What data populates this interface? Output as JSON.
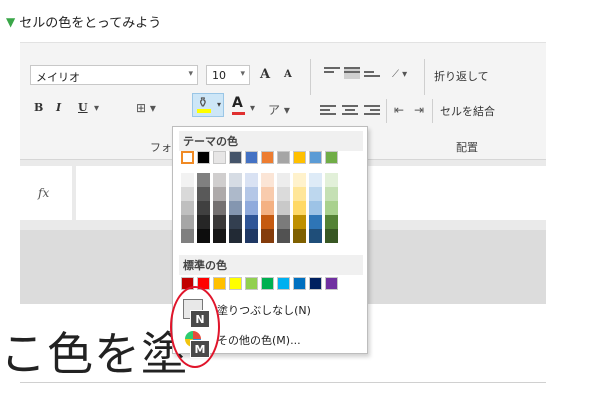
{
  "heading": "セルの色をとってみよう",
  "ribbon": {
    "font_name": "メイリオ",
    "font_size": "10",
    "bold": "B",
    "italic": "I",
    "underline": "U",
    "grow_font": "A",
    "shrink_font": "A",
    "font_color_label": "A",
    "wrap_label": "折り返して",
    "merge_label": "セルを結合",
    "font_group": "フォント",
    "align_group": "配置",
    "fill_color": "#ffff00",
    "font_color": "#e03030"
  },
  "formula_bar": {
    "fx": "fx"
  },
  "sheet": {
    "big_text": "こ色を塗"
  },
  "dropdown": {
    "theme_title": "テーマの色",
    "standard_title": "標準の色",
    "no_fill": "塗りつぶしなし(N)",
    "more_colors": "その他の色(M)...",
    "key_n": "N",
    "key_m": "M",
    "theme_colors": [
      "#ffffff",
      "#000000",
      "#e7e6e6",
      "#44546a",
      "#4472c4",
      "#ed7d31",
      "#a5a5a5",
      "#ffc000",
      "#5b9bd5",
      "#70ad47"
    ],
    "theme_shades": [
      [
        "#f2f2f2",
        "#d9d9d9",
        "#bfbfbf",
        "#a6a6a6",
        "#808080"
      ],
      [
        "#808080",
        "#595959",
        "#404040",
        "#262626",
        "#0d0d0d"
      ],
      [
        "#d0cece",
        "#aeaaaa",
        "#757171",
        "#3a3838",
        "#171616"
      ],
      [
        "#d6dce4",
        "#adb9ca",
        "#8496b0",
        "#333f50",
        "#222a35"
      ],
      [
        "#d9e2f3",
        "#b4c7e7",
        "#8faadc",
        "#2f5597",
        "#1f3864"
      ],
      [
        "#fbe5d6",
        "#f8cbad",
        "#f4b183",
        "#c55a11",
        "#843c0c"
      ],
      [
        "#ededed",
        "#dbdbdb",
        "#c9c9c9",
        "#7b7b7b",
        "#525252"
      ],
      [
        "#fff2cc",
        "#ffe699",
        "#ffd966",
        "#bf9000",
        "#7f6000"
      ],
      [
        "#deebf7",
        "#bdd7ee",
        "#9dc3e6",
        "#2e75b6",
        "#1f4e79"
      ],
      [
        "#e2f0d9",
        "#c5e0b4",
        "#a9d18e",
        "#548235",
        "#385723"
      ]
    ],
    "standard_colors": [
      "#c00000",
      "#ff0000",
      "#ffc000",
      "#ffff00",
      "#92d050",
      "#00b050",
      "#00b0f0",
      "#0070c0",
      "#002060",
      "#7030a0"
    ]
  }
}
